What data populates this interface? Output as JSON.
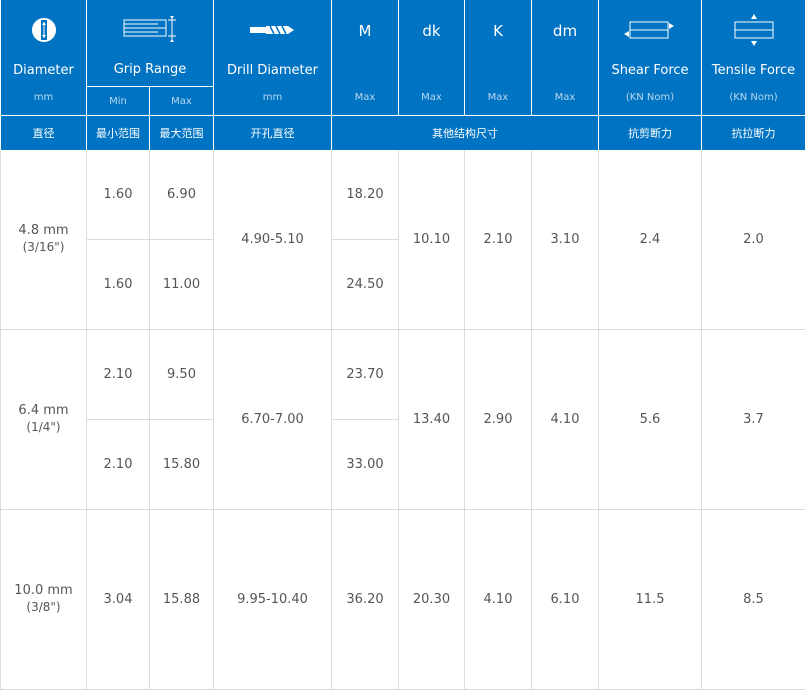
{
  "header": {
    "diameter": {
      "label": "Diameter",
      "unit": "mm",
      "cn": "直径",
      "icon": "rivet-end-icon"
    },
    "grip_range": {
      "label": "Grip Range",
      "min": "Min",
      "max": "Max",
      "cn_min": "最小范围",
      "cn_max": "最大范围",
      "icon": "grip-range-icon"
    },
    "drill_diameter": {
      "label": "Drill Diameter",
      "unit": "mm",
      "cn": "开孔直径",
      "icon": "drill-bit-icon"
    },
    "m": {
      "label": "M",
      "unit": "Max"
    },
    "dk": {
      "label": "dk",
      "unit": "Max"
    },
    "k": {
      "label": "K",
      "unit": "Max"
    },
    "dm": {
      "label": "dm",
      "unit": "Max"
    },
    "other_dims_cn": "其他结构尺寸",
    "shear_force": {
      "label": "Shear Force",
      "unit": "(KN Nom)",
      "cn": "抗剪断力",
      "icon": "shear-force-icon"
    },
    "tensile_force": {
      "label": "Tensile Force",
      "unit": "(KN Nom)",
      "cn": "抗拉断力",
      "icon": "tensile-force-icon"
    }
  },
  "rows": [
    {
      "diameter": "4.8 mm",
      "diameter_inch": "(3/16\")",
      "grip": [
        {
          "min": "1.60",
          "max": "6.90",
          "m": "18.20"
        },
        {
          "min": "1.60",
          "max": "11.00",
          "m": "24.50"
        }
      ],
      "drill": "4.90-5.10",
      "dk": "10.10",
      "k": "2.10",
      "dm": "3.10",
      "shear": "2.4",
      "tensile": "2.0"
    },
    {
      "diameter": "6.4 mm",
      "diameter_inch": "(1/4\")",
      "grip": [
        {
          "min": "2.10",
          "max": "9.50",
          "m": "23.70"
        },
        {
          "min": "2.10",
          "max": "15.80",
          "m": "33.00"
        }
      ],
      "drill": "6.70-7.00",
      "dk": "13.40",
      "k": "2.90",
      "dm": "4.10",
      "shear": "5.6",
      "tensile": "3.7"
    },
    {
      "diameter": "10.0 mm",
      "diameter_inch": "(3/8\")",
      "grip": [
        {
          "min": "3.04",
          "max": "15.88",
          "m": "36.20"
        }
      ],
      "drill": "9.95-10.40",
      "dk": "20.30",
      "k": "4.10",
      "dm": "6.10",
      "shear": "11.5",
      "tensile": "8.5"
    }
  ]
}
